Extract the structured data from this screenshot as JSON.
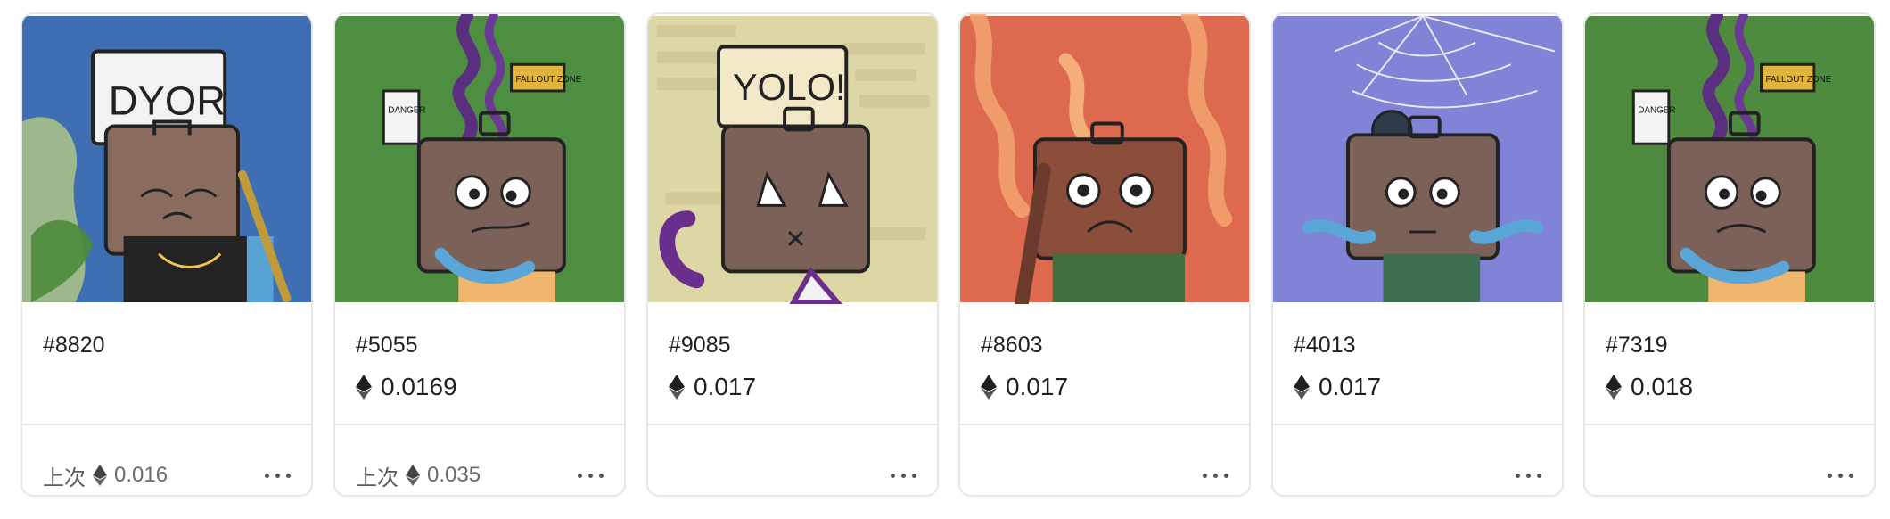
{
  "cards": [
    {
      "title": "#8820",
      "price": "",
      "last_label": "上次",
      "last_price": "0.016",
      "sign_text": "DYOR",
      "bg": "#3f6fb3"
    },
    {
      "title": "#5055",
      "price": "0.0169",
      "last_label": "上次",
      "last_price": "0.035",
      "sign_text": "DANGER",
      "sign_text_2": "FALLOUT ZONE",
      "bg": "#4e8e41"
    },
    {
      "title": "#9085",
      "price": "0.017",
      "last_label": "",
      "last_price": "",
      "sign_text": "YOLO!",
      "bg": "#dcd7a4"
    },
    {
      "title": "#8603",
      "price": "0.017",
      "last_label": "",
      "last_price": "",
      "bg": "#dd6a4f"
    },
    {
      "title": "#4013",
      "price": "0.017",
      "last_label": "",
      "last_price": "",
      "bg": "#8083d6"
    },
    {
      "title": "#7319",
      "price": "0.018",
      "last_label": "",
      "last_price": "",
      "sign_text": "DANGER",
      "sign_text_2": "FALLOUT ZONE",
      "bg": "#4f8b3f"
    }
  ],
  "icons": {
    "currency_icon": "ethereum-icon",
    "menu_icon": "more-horizontal-icon"
  },
  "colors": {
    "card_border": "#e6e6e6",
    "text": "#1f1f1f",
    "muted_text": "#6b6b6b"
  }
}
